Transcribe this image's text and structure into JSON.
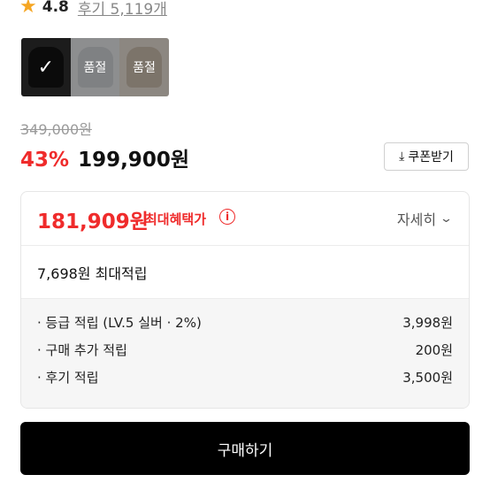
{
  "rating": {
    "star_icon": "star-icon",
    "value": "4.8",
    "review_text": "후기 5,119개"
  },
  "options": [
    {
      "label": "",
      "state": "selected"
    },
    {
      "label": "품절",
      "state": "soldout"
    },
    {
      "label": "품절",
      "state": "soldout"
    }
  ],
  "price": {
    "original": "349,000원",
    "discount": "43%",
    "sale": "199,900원",
    "coupon_label": "쿠폰받기",
    "coupon_icon": "download-icon"
  },
  "benefit": {
    "max_price": "181,909원",
    "max_label": "최대혜택가",
    "info_icon": "i",
    "detail_label": "자세히",
    "points_summary": "7,698원 최대적립",
    "points": [
      {
        "label": "· 등급 적립 (LV.5 실버 · 2%)",
        "value": "3,998원"
      },
      {
        "label": "· 구매 추가 적립",
        "value": "200원"
      },
      {
        "label": "· 후기 적립",
        "value": "3,500원"
      }
    ]
  },
  "buy_label": "구매하기",
  "colors": {
    "accent_red": "#ef2b2b",
    "star": "#f5a623",
    "button_bg": "#000000"
  }
}
